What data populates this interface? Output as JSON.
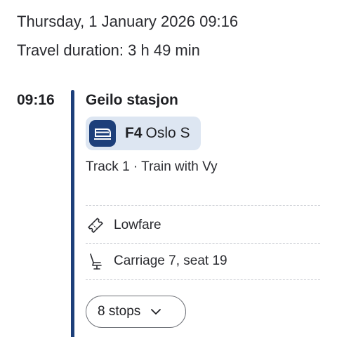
{
  "trip": {
    "date_time": "Thursday, 1 January 2026 09:16",
    "duration": "Travel duration: 3 h 49 min"
  },
  "leg": {
    "departure_time": "09:16",
    "station": "Geilo stasjon",
    "line_code": "F4",
    "destination": "Oslo S",
    "track_info": "Track 1 · Train with Vy",
    "fare": "Lowfare",
    "seat": "Carriage 7, seat 19",
    "stops_label": "8 stops"
  },
  "icons": {
    "train": "train-icon",
    "ticket": "ticket-icon",
    "seat": "seat-icon",
    "chevron": "chevron-down-icon"
  },
  "colors": {
    "brand": "#1d3f7a",
    "chip_background": "#dde6f2"
  }
}
